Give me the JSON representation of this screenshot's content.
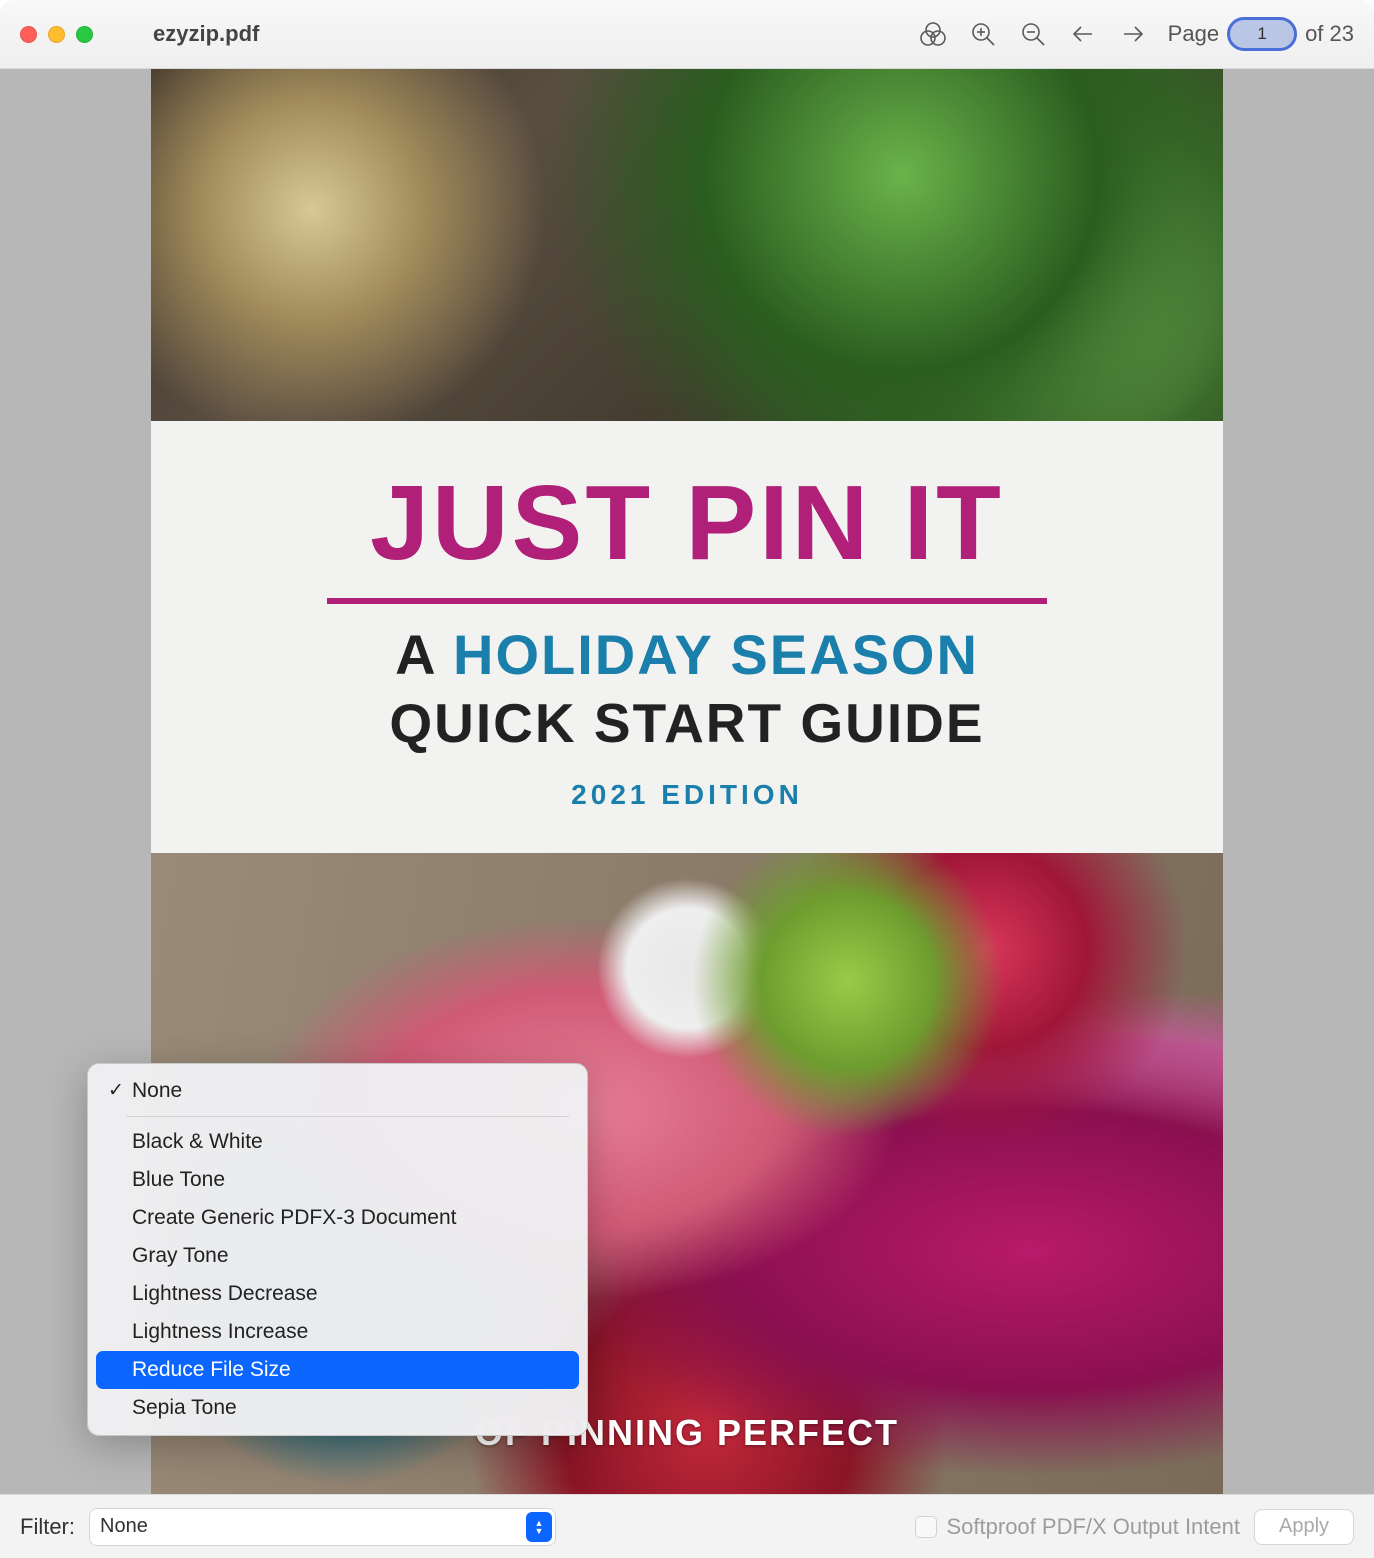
{
  "window": {
    "title": "ezyzip.pdf"
  },
  "toolbar": {
    "page_label": "Page",
    "page_value": "1",
    "page_total": "of 23"
  },
  "cover": {
    "title": "JUST PIN IT",
    "sub_a": "A",
    "sub_holiday": "HOLIDAY SEASON",
    "sub_quick": "QUICK START GUIDE",
    "edition": "2021 EDITION",
    "footer": "OF PINNING PERFECT"
  },
  "menu": {
    "items": [
      {
        "label": "None",
        "checked": true,
        "highlighted": false,
        "sep_after": true
      },
      {
        "label": "Black & White",
        "checked": false,
        "highlighted": false
      },
      {
        "label": "Blue Tone",
        "checked": false,
        "highlighted": false
      },
      {
        "label": "Create Generic PDFX-3 Document",
        "checked": false,
        "highlighted": false
      },
      {
        "label": "Gray Tone",
        "checked": false,
        "highlighted": false
      },
      {
        "label": "Lightness Decrease",
        "checked": false,
        "highlighted": false
      },
      {
        "label": "Lightness Increase",
        "checked": false,
        "highlighted": false
      },
      {
        "label": "Reduce File Size",
        "checked": false,
        "highlighted": true
      },
      {
        "label": "Sepia Tone",
        "checked": false,
        "highlighted": false
      }
    ]
  },
  "bottombar": {
    "filter_label": "Filter:",
    "filter_value": "None",
    "softproof_label": "Softproof PDF/X Output Intent",
    "apply_label": "Apply"
  }
}
